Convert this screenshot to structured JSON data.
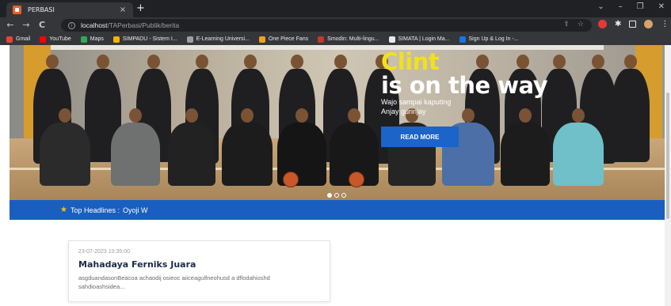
{
  "browser": {
    "tab_title": "PERBASI",
    "tab_close": "×",
    "new_tab": "+",
    "url_host": "localhost",
    "url_path": "/TAPerbasi/Publik/berita",
    "back": "←",
    "forward": "→",
    "reload": "C",
    "window_controls": [
      "⌄",
      "–",
      "❐",
      "✕"
    ],
    "bookmarks": [
      {
        "label": "Gmail",
        "color": "#ea4335"
      },
      {
        "label": "YouTube",
        "color": "#ff0000"
      },
      {
        "label": "Maps",
        "color": "#34a853"
      },
      {
        "label": "SIMPADU - Sistem I...",
        "color": "#f4b400"
      },
      {
        "label": "E-Learning Universi...",
        "color": "#9aa0a6"
      },
      {
        "label": "One Piece Fans",
        "color": "#f0a21a"
      },
      {
        "label": "Smodin: Multi-lingu...",
        "color": "#c0392b"
      },
      {
        "label": "SIMATA | Login Ma...",
        "color": "#e8eaed"
      },
      {
        "label": "Sign Up & Log In -...",
        "color": "#1a73e8"
      }
    ]
  },
  "hero": {
    "title_line1": "Clint",
    "title_line2": "is on the way",
    "subtitle_line1": "Wajo sampai kaputing",
    "subtitle_line2": "Anjay gurinjay",
    "cta_label": "READ MORE",
    "slides": 3,
    "active_slide": 1
  },
  "headlines": {
    "star": "★",
    "label": "Top Headlines :",
    "text": "Oyoji W"
  },
  "news": [
    {
      "date": "23-07-2023 10:35:00",
      "title": "Mahadaya Ferniks Juara",
      "excerpt": "asgduandasonBeacoa achaodij osieoc aiiceagulfneohusd a dflodahioshd sahdioashsidea..."
    }
  ],
  "colors": {
    "accent_blue": "#1a5fc0",
    "hero_title_yellow": "#f2e11a",
    "star_yellow": "#f2c21a"
  }
}
